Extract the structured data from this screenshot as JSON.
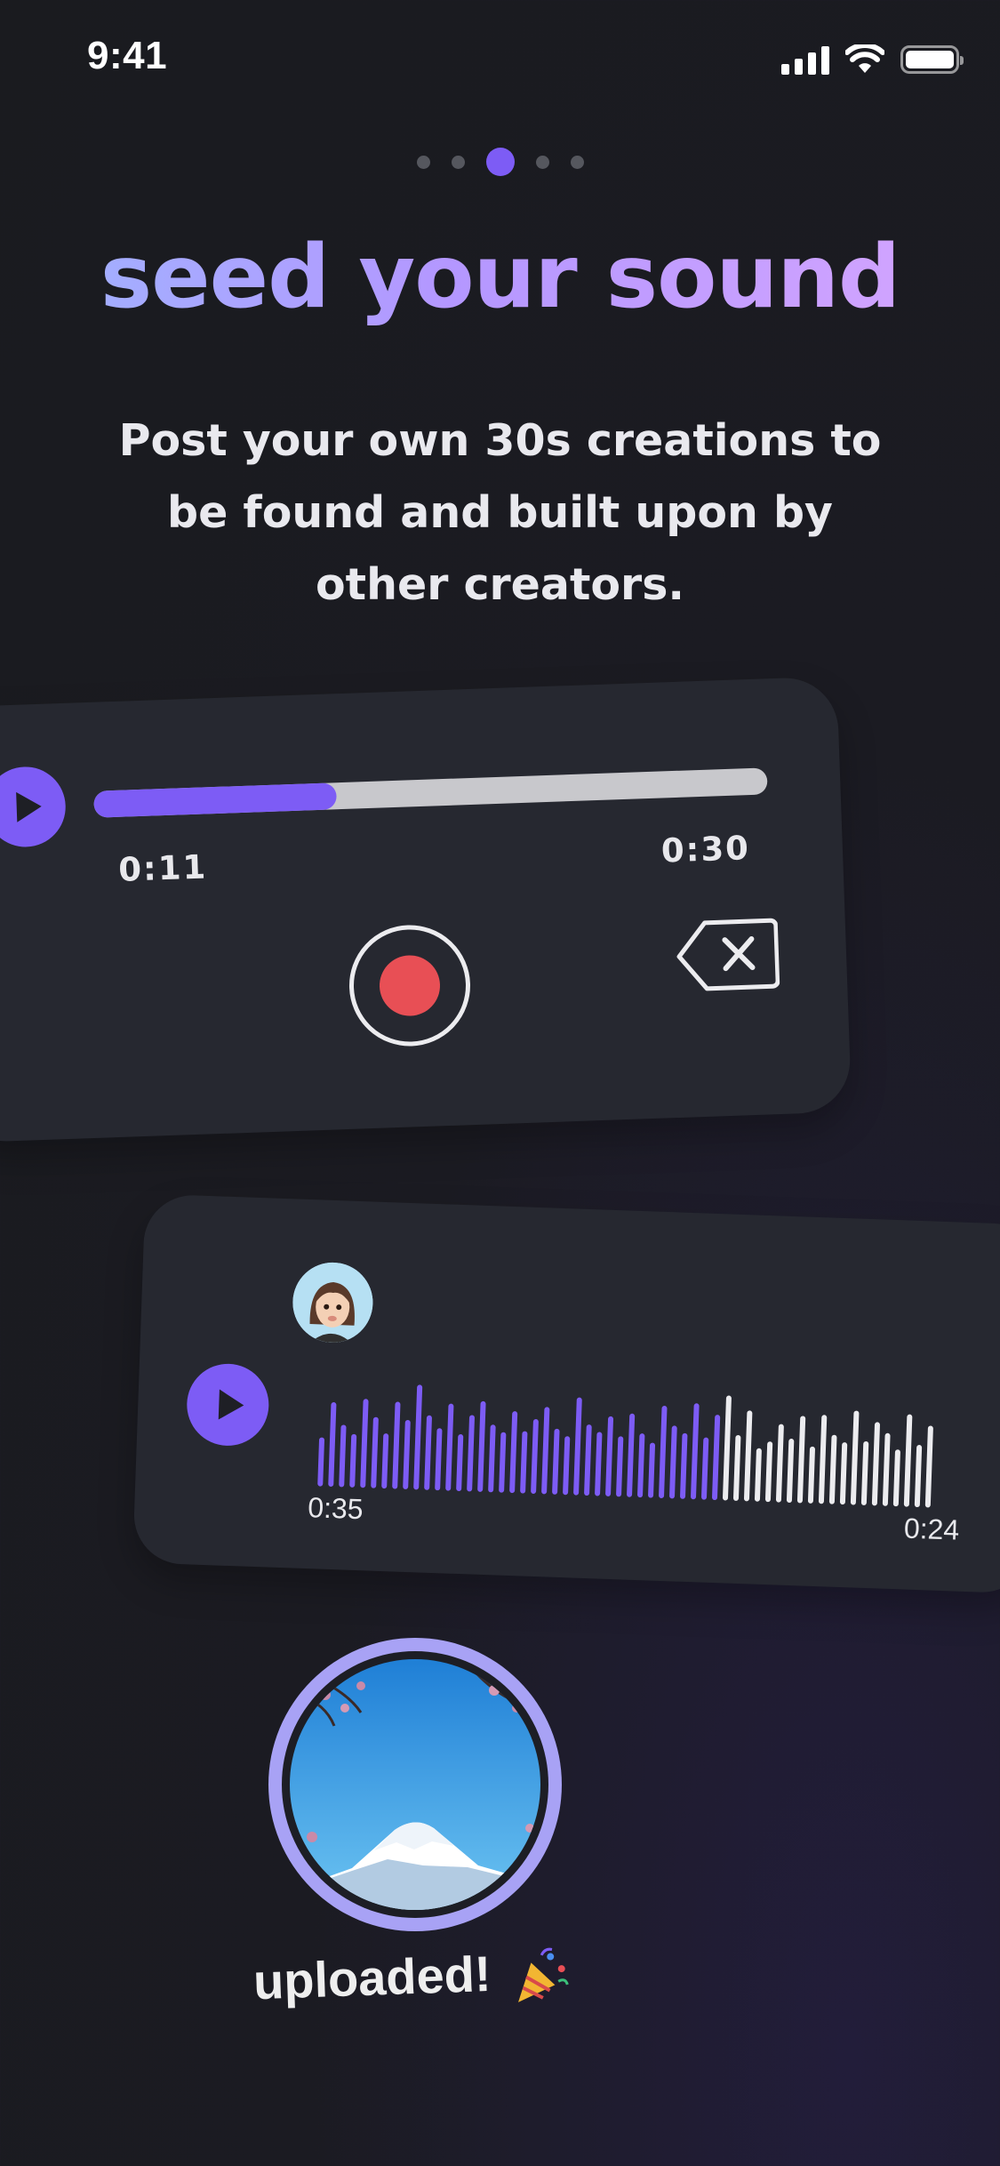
{
  "status_bar": {
    "time": "9:41",
    "icons": [
      "signal-icon",
      "wifi-icon",
      "battery-icon"
    ]
  },
  "pager": {
    "count": 5,
    "active_index": 2
  },
  "headline": "seed your sound",
  "subtitle": "Post your own 30s creations to be found and built upon by other creators.",
  "recorder": {
    "elapsed": "0:11",
    "total": "0:30",
    "progress": 0.36,
    "icons": [
      "play-icon",
      "record-icon",
      "delete-icon"
    ]
  },
  "waveform": {
    "left_time": "0:35",
    "right_time": "0:24",
    "played_fraction": 0.66,
    "icons": [
      "play-icon",
      "avatar"
    ]
  },
  "upload": {
    "label": "uploaded!",
    "emoji": "party-popper-icon"
  },
  "colors": {
    "accent": "#7d5cf5",
    "record": "#e84f55",
    "card": "#262830",
    "background": "#1a1b1f"
  }
}
